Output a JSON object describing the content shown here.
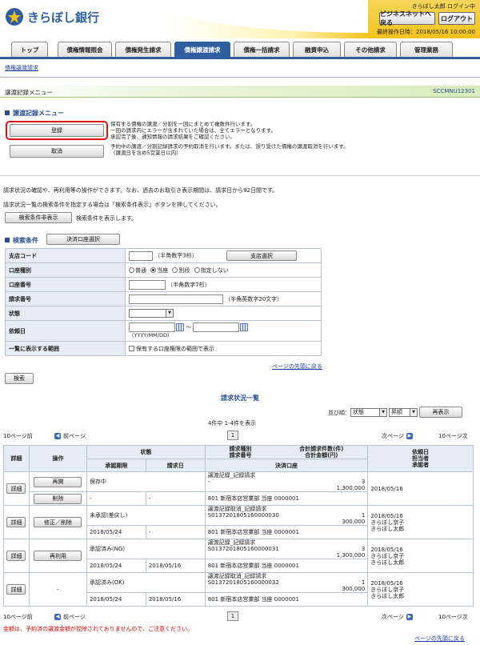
{
  "header": {
    "bank_name": "きらぼし銀行",
    "user_login": "きらぼし太郎 ログイン中",
    "business_net_button": "ビジネスネットへ戻る",
    "logout_button": "ログアウト",
    "last_operation": "最終操作日時：2018/05/16 10:00:00"
  },
  "tabs": [
    {
      "label": "トップ"
    },
    {
      "label": "債権情報照会"
    },
    {
      "label": "債権発生請求"
    },
    {
      "label": "債権譲渡請求"
    },
    {
      "label": "債権一括請求"
    },
    {
      "label": "融資申込"
    },
    {
      "label": "その他請求"
    },
    {
      "label": "管理業務"
    }
  ],
  "subnav": "債権譲渡請求",
  "page_bar": {
    "title": "譲渡記録メニュー",
    "code": "SCCMNU12301"
  },
  "menu_section": {
    "title": "譲渡記録メニュー",
    "register_button": "登録",
    "register_desc": [
      "保有する債権の譲渡／分割を一回にまとめて複数件行います。",
      "一回の請求内にエラーが含まれていた場合は、全てエラーとなります。",
      "承認完了後、通知情報の請求結果をご確認ください。"
    ],
    "cancel_button": "取消",
    "cancel_desc": [
      "予約中の譲渡／分割記録請求の予約取消を行います。または、誤り受けた債権の譲渡取消を行います。",
      "（譲渡日を含め5営業日以内）"
    ]
  },
  "info_text": {
    "line1": "請求状況の確認や、再利用等の操作ができます。なお、過去のお取引き表示期間は、請求日から92日間です。",
    "line2": "請求状況一覧の検索条件を指定する場合は「検索条件表示」ボタンを押してください。",
    "toggle_button": "検索条件非表示",
    "toggle_desc": "検索条件を表示します。"
  },
  "search": {
    "title": "検索条件",
    "account_select_button": "決済口座選択",
    "branch_code_label": "支店コード",
    "branch_code_hint": "（半角数字3桁）",
    "branch_select_button": "支店選択",
    "account_type_label": "口座種別",
    "account_types": [
      "普通",
      "当座",
      "別段",
      "指定しない"
    ],
    "account_number_label": "口座番号",
    "account_number_hint": "（半角数字7桁）",
    "request_number_label": "請求番号",
    "request_number_hint": "（半角英数字20文字）",
    "status_label": "状態",
    "request_date_label": "依頼日",
    "date_separator": "～",
    "date_format_hint": "（YYYY/MM/DD）",
    "range_label": "一覧に表示する範囲",
    "range_check": "保有する口座権限の範囲で表示",
    "page_top_link": "ページの先頭に戻る",
    "search_button": "検索"
  },
  "results": {
    "title": "請求状況一覧",
    "sort_label": "並び順：",
    "sort_field": "状態",
    "sort_order": "昇順",
    "redisplay_button": "再表示",
    "count_text": "4件中 1-4件を表示",
    "prev10": "10ページ前",
    "prev": "前ページ",
    "page": "1",
    "next": "次ページ",
    "next10": "10ページ次",
    "headers": {
      "detail": "詳細",
      "operation": "操作",
      "status": "状態",
      "approval_deadline": "承認期限",
      "request_date": "請求日",
      "request_type": "請求種別",
      "request_number": "請求番号",
      "total_count": "合計請求件数(件)",
      "total_amount": "合計金額(円)",
      "settlement_account": "決済口座",
      "requester": "依頼日",
      "staff": "担当者",
      "approver": "承認者"
    },
    "rows": [
      {
        "detail": "詳細",
        "ops": [
          "再開",
          "削除"
        ],
        "status": "保存中",
        "deadline": "-",
        "date": "-",
        "type": "譲渡記録_記録請求",
        "number": "-",
        "count": "3",
        "amount": "1,300,000",
        "account": "801 新宿本店営業部 当座 0000001",
        "req_date": "2018/05/16",
        "staff": "",
        "approver": ""
      },
      {
        "detail": "詳細",
        "ops": [
          "修正／削除"
        ],
        "status": "未承認(差戻し)",
        "deadline": "2018/05/24",
        "date": "-",
        "type": "譲渡記録取消_記録請求",
        "number": "S0137201805160000030",
        "count": "1",
        "amount": "300,000",
        "account": "801 新宿本店営業部 当座 0000001",
        "req_date": "2018/05/16",
        "staff": "きらぼし京子",
        "approver": "きらぼし太郎"
      },
      {
        "detail": "詳細",
        "ops": [
          "再利用"
        ],
        "status": "承認済み(NG)",
        "deadline": "2018/05/24",
        "date": "2018/05/16",
        "type": "譲渡記録_記録請求",
        "number": "S0137201805160000031",
        "count": "3",
        "amount": "1,300,000",
        "account": "801 新宿本店営業部 当座 0000001",
        "req_date": "2018/05/16",
        "staff": "きらぼし京子",
        "approver": "きらぼし太郎"
      },
      {
        "detail": "詳細",
        "ops": [
          "-"
        ],
        "status": "承認済み(OK)",
        "deadline": "2018/05/24",
        "date": "2018/05/16",
        "type": "譲渡記録取消_記録請求",
        "number": "S0137201805160000032",
        "count": "1",
        "amount": "300,000",
        "account": "801 新宿本店営業部 当座 0000001",
        "req_date": "2018/05/16",
        "staff": "きらぼし京子",
        "approver": "きらぼし太郎"
      }
    ],
    "warning": "金額は、予約済の譲渡金額が控除されておりませんので、ご注意ください。",
    "page_top_link": "ページの先頭に戻る"
  },
  "colors": {
    "brand_blue": "#2f5fa0",
    "logo_yellow": "#f3c21b",
    "warning_red": "#d40000",
    "highlight_red": "#e01010"
  }
}
